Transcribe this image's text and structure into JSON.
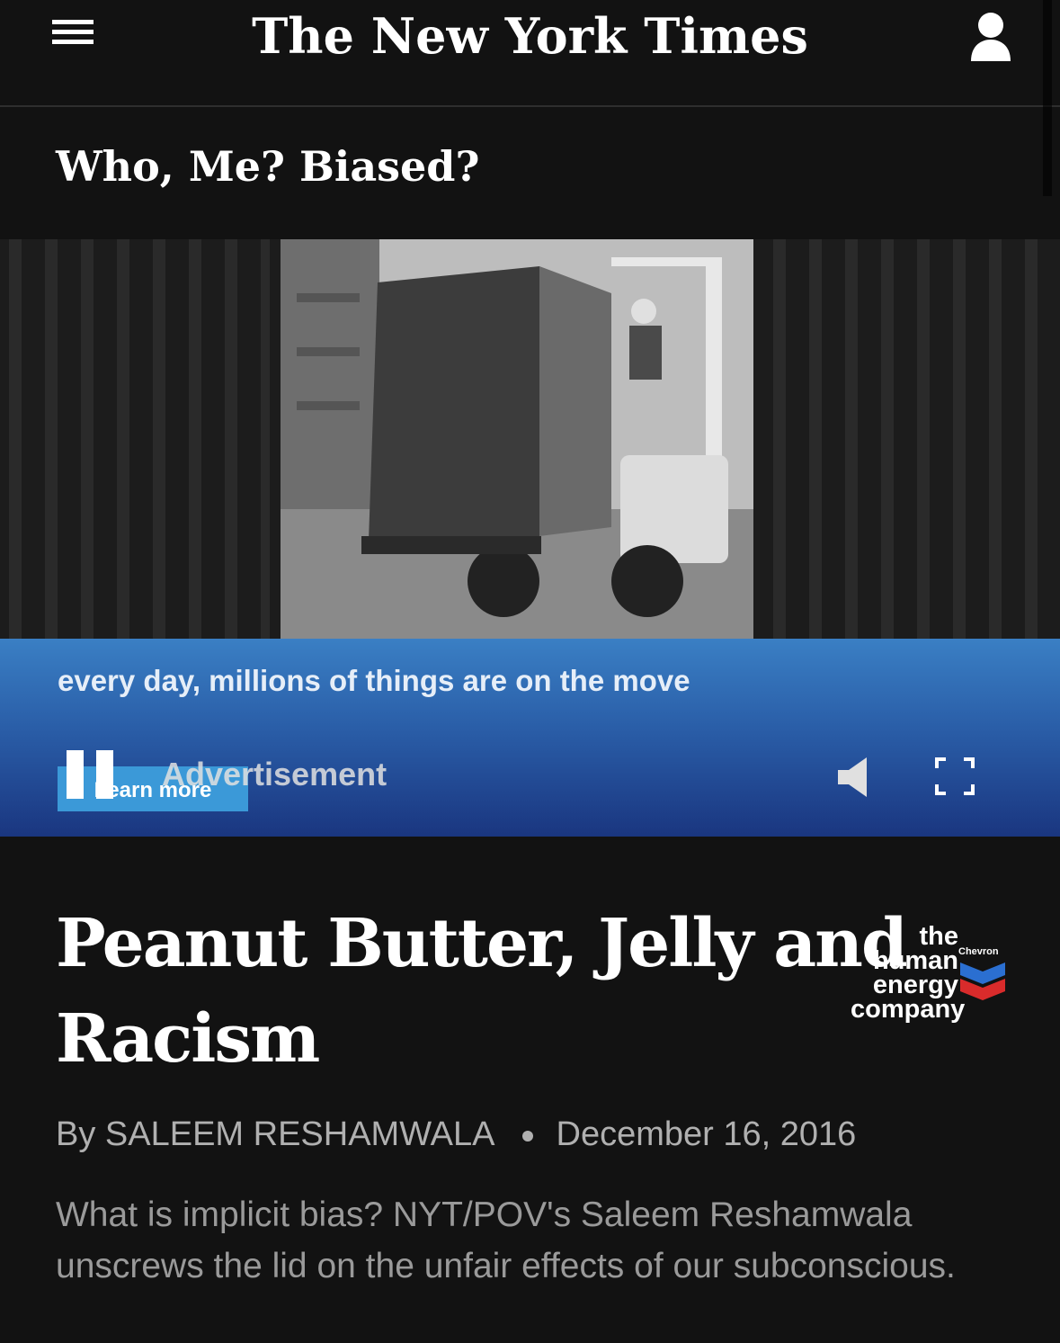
{
  "header": {
    "logo": "The New York Times",
    "menu_icon": "hamburger-menu-icon",
    "account_icon": "user-account-icon"
  },
  "section": {
    "title": "Who, Me? Biased?"
  },
  "ad": {
    "tagline": "every day, millions of things are on the move",
    "learn_more": "Learn more",
    "label": "Advertisement",
    "brand_lines": [
      "the",
      "human",
      "energy",
      "company"
    ],
    "brand_name": "Chevron",
    "colors": {
      "band_top": "#3a7fc4",
      "band_bottom": "#1a3680",
      "button": "#3b99d8"
    }
  },
  "article": {
    "headline": "Peanut Butter, Jelly and Racism",
    "byline": "By SALEEM RESHAMWALA",
    "date": "December 16, 2016",
    "summary": "What is implicit bias? NYT/POV's Saleem Reshamwala unscrews the lid on the unfair effects of our subconscious."
  }
}
